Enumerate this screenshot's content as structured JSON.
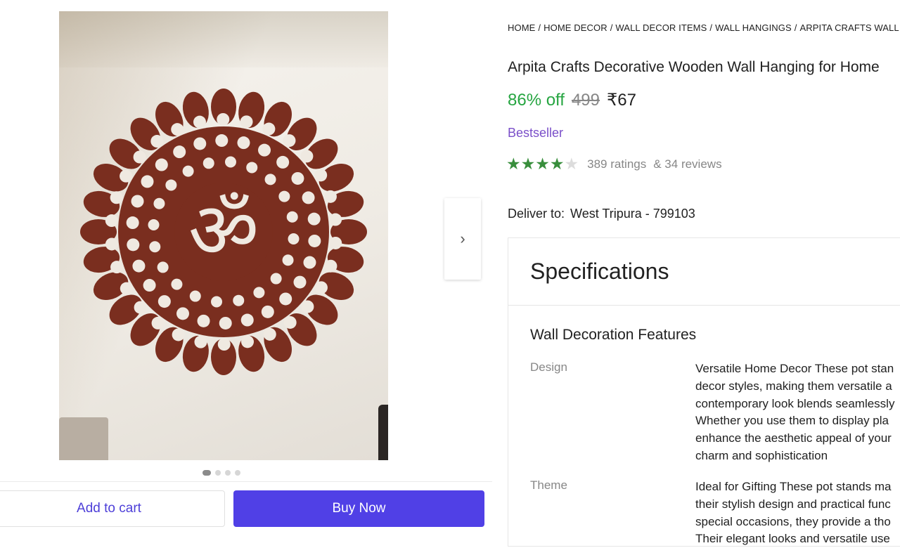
{
  "gallery": {
    "next_icon": "›",
    "dots": [
      true,
      false,
      false,
      false
    ]
  },
  "actions": {
    "add_to_cart": "Add to cart",
    "buy_now": "Buy Now"
  },
  "breadcrumb": [
    "HOME",
    "HOME DECOR",
    "WALL DECOR ITEMS",
    "WALL HANGINGS",
    "ARPITA CRAFTS WALL"
  ],
  "product": {
    "title": "Arpita Crafts Decorative Wooden Wall Hanging for Home",
    "discount": "86% off",
    "mrp": "499",
    "price": "₹67",
    "badge": "Bestseller",
    "rating_stars": 4,
    "ratings": "389 ratings",
    "reviews": "& 34 reviews"
  },
  "delivery": {
    "label": "Deliver to:",
    "location": "West Tripura - 799103"
  },
  "specifications": {
    "heading": "Specifications",
    "group": "Wall Decoration Features",
    "rows": [
      {
        "label": "Design",
        "lines": [
          "Versatile Home Decor These pot stan",
          "decor styles, making them versatile a",
          "contemporary look blends seamlessly",
          "Whether you use them to display pla",
          "enhance the aesthetic appeal of your",
          "charm and sophistication"
        ]
      },
      {
        "label": "Theme",
        "lines": [
          "Ideal for Gifting These pot stands ma",
          "their stylish design and practical func",
          "special occasions, they provide a tho",
          "Their elegant looks and versatile use"
        ]
      }
    ]
  },
  "colors": {
    "accent": "#5040e6",
    "discount_green": "#26a541",
    "star_green": "#388e3c",
    "badge_purple": "#7a4fc9"
  }
}
